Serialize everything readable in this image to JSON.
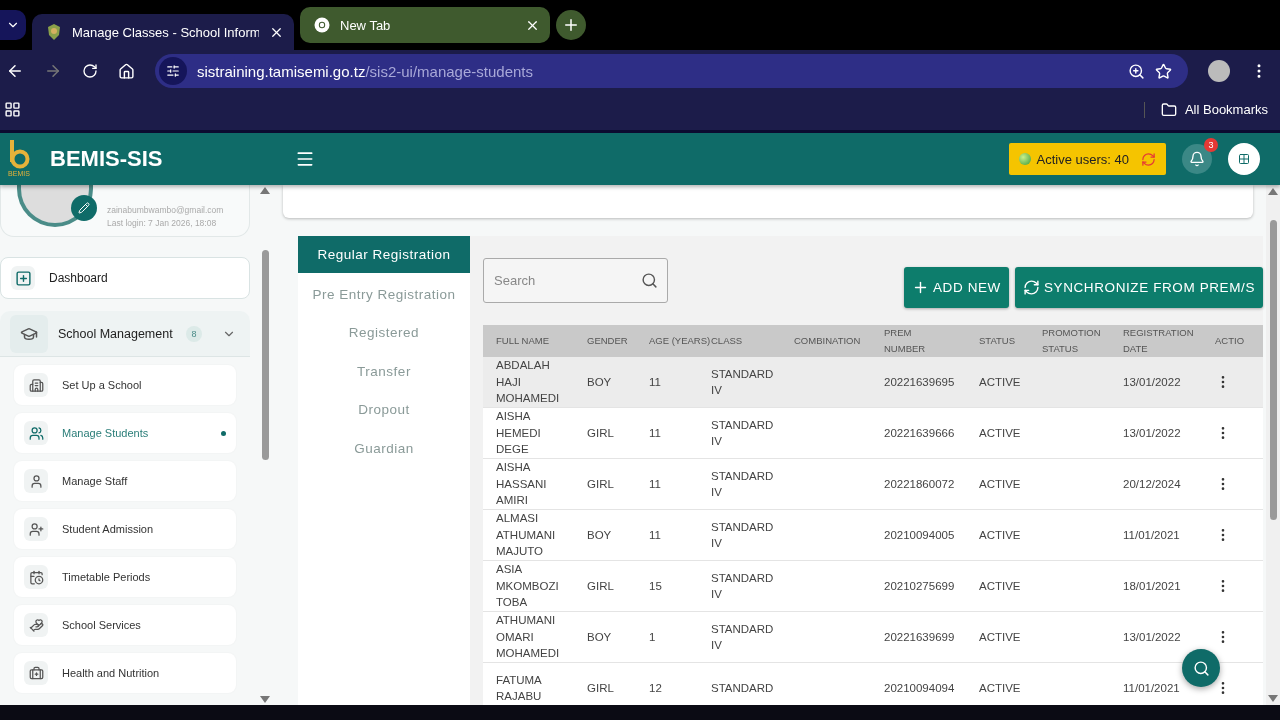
{
  "browser": {
    "tabs": [
      {
        "title": "Manage Classes - School Inform",
        "selected": true
      },
      {
        "title": "New Tab",
        "selected": false
      }
    ],
    "url": {
      "host": "sistraining.tamisemi.go.tz",
      "path": "/sis2-ui/manage-students"
    },
    "bookmarks_label": "All Bookmarks"
  },
  "app_header": {
    "title": "BEMIS-SIS",
    "logo_caption": "BEMIS",
    "active_users": "Active users: 40",
    "notification_count": "3"
  },
  "profile": {
    "email": "zainabumbwambo@gmail.com",
    "last_login": "Last login: 7 Jan 2026, 18:08"
  },
  "sidebar": {
    "dashboard": "Dashboard",
    "group": {
      "label": "School Management",
      "count": "8",
      "expanded": true,
      "children": [
        {
          "label": "Set Up a School",
          "selected": false
        },
        {
          "label": "Manage Students",
          "selected": true
        },
        {
          "label": "Manage Staff",
          "selected": false
        },
        {
          "label": "Student Admission",
          "selected": false
        },
        {
          "label": "Timetable Periods",
          "selected": false
        },
        {
          "label": "School Services",
          "selected": false
        },
        {
          "label": "Health and Nutrition",
          "selected": false
        }
      ]
    }
  },
  "registration_tabs": [
    {
      "label": "Regular Registration",
      "selected": true
    },
    {
      "label": "Pre Entry Registration",
      "selected": false
    },
    {
      "label": "Registered",
      "selected": false
    },
    {
      "label": "Transfer",
      "selected": false
    },
    {
      "label": "Dropout",
      "selected": false
    },
    {
      "label": "Guardian",
      "selected": false
    }
  ],
  "search": {
    "placeholder": "Search"
  },
  "buttons": {
    "add_new": "ADD NEW",
    "synchronize": "SYNCHRONIZE FROM PREM/S"
  },
  "table": {
    "columns": [
      "FULL NAME",
      "GENDER",
      "AGE (YEARS)",
      "CLASS",
      "COMBINATION",
      "PREM NUMBER",
      "STATUS",
      "PROMOTION STATUS",
      "REGISTRATION DATE",
      "ACTIO"
    ],
    "rows": [
      {
        "full_name": "ABDALAH HAJI MOHAMEDI",
        "gender": "BOY",
        "age": "11",
        "class": "STANDARD IV",
        "prem_number": "20221639695",
        "status": "ACTIVE",
        "registration_date": "13/01/2022",
        "highlighted": true
      },
      {
        "full_name": "AISHA HEMEDI DEGE",
        "gender": "GIRL",
        "age": "11",
        "class": "STANDARD IV",
        "prem_number": "20221639666",
        "status": "ACTIVE",
        "registration_date": "13/01/2022",
        "highlighted": false
      },
      {
        "full_name": "AISHA HASSANI AMIRI",
        "gender": "GIRL",
        "age": "11",
        "class": "STANDARD IV",
        "prem_number": "20221860072",
        "status": "ACTIVE",
        "registration_date": "20/12/2024",
        "highlighted": false
      },
      {
        "full_name": "ALMASI ATHUMANI MAJUTO",
        "gender": "BOY",
        "age": "11",
        "class": "STANDARD IV",
        "prem_number": "20210094005",
        "status": "ACTIVE",
        "registration_date": "11/01/2021",
        "highlighted": false
      },
      {
        "full_name": "ASIA MKOMBOZI TOBA",
        "gender": "GIRL",
        "age": "15",
        "class": "STANDARD IV",
        "prem_number": "20210275699",
        "status": "ACTIVE",
        "registration_date": "18/01/2021",
        "highlighted": false
      },
      {
        "full_name": "ATHUMANI OMARI MOHAMEDI",
        "gender": "BOY",
        "age": "1",
        "class": "STANDARD IV",
        "prem_number": "20221639699",
        "status": "ACTIVE",
        "registration_date": "13/01/2022",
        "highlighted": false
      },
      {
        "full_name": "FATUMA RAJABU",
        "gender": "GIRL",
        "age": "12",
        "class": "STANDARD",
        "prem_number": "20210094094",
        "status": "ACTIVE",
        "registration_date": "11/01/2021",
        "highlighted": false
      }
    ]
  }
}
